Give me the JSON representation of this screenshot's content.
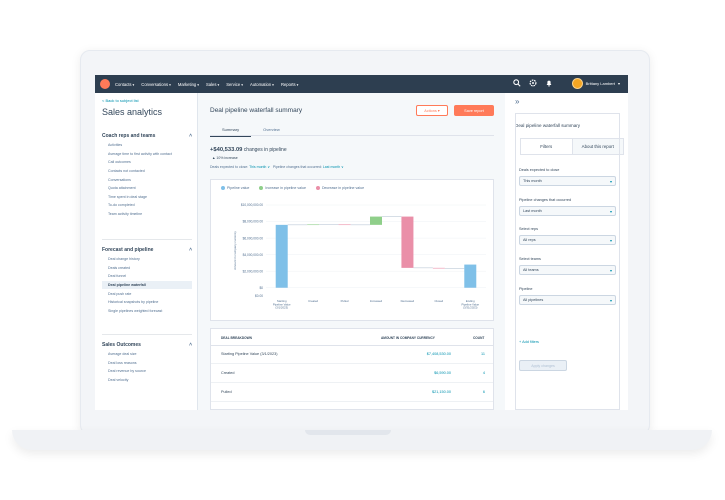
{
  "topnav": {
    "items": [
      "Contacts",
      "Conversations",
      "Marketing",
      "Sales",
      "Service",
      "Automation",
      "Reports"
    ],
    "user_name": "Brittany Lambert"
  },
  "sidebar": {
    "back_link": "< Back to subject list",
    "title": "Sales analytics",
    "sections": [
      {
        "title": "Coach reps and teams",
        "items": [
          "Activities",
          "Average time to first activity with contact",
          "Call outcomes",
          "Contacts not contacted",
          "Conversations",
          "Quota attainment",
          "Time spent in deal stage",
          "To-do completed",
          "Team activity timeline"
        ]
      },
      {
        "title": "Forecast and pipeline",
        "items": [
          "Deal change history",
          "Deals created",
          "Deal funnel",
          "Deal pipeline waterfall",
          "Deal push rate",
          "Historical snapshots by pipeline",
          "Single pipelines weighted forecast"
        ]
      },
      {
        "title": "Sales Outcomes",
        "items": [
          "Average deal size",
          "Deal loss reasons",
          "Deal revenue by source",
          "Deal velocity"
        ]
      }
    ]
  },
  "main": {
    "title": "Deal pipeline waterfall summary",
    "actions_label": "Actions ▾",
    "save_label": "Save report",
    "tabs": [
      "Summary",
      "Overview"
    ],
    "summary_value": "+$40,533.09",
    "summary_text": "changes in pipeline",
    "summary_pct": "▲ 10% increase",
    "filter_prefix": "Deals expected to close:",
    "filter_1": "This month ∨",
    "filter_mid": "Pipeline changes that occurred:",
    "filter_2": "Last month ∨",
    "table": {
      "headers": [
        "DEAL BREAKDOWN",
        "AMOUNT IN COMPANY CURRENCY",
        "COUNT"
      ],
      "rows": [
        {
          "label": "Starting Pipeline Value (3/1/2023)",
          "amount": "$7,408,530.00",
          "count": "11"
        },
        {
          "label": "Created",
          "amount": "$6,590.00",
          "count": "4"
        },
        {
          "label": "Pulled",
          "amount": "$21,150.00",
          "count": "6"
        }
      ]
    }
  },
  "chart_data": {
    "type": "bar",
    "subtype": "waterfall",
    "legend": [
      "Pipeline value",
      "Increase in pipeline value",
      "Decrease in pipeline value"
    ],
    "colors": {
      "pipeline": "#7fc0e8",
      "increase": "#8fcf8a",
      "decrease": "#ea8fa8"
    },
    "ylabel": "Amount in company currency",
    "yticks": [
      "$10,000,000.00",
      "$8,000,000.00",
      "$6,000,000.00",
      "$4,000,000.00",
      "$2,000,000.00",
      "$0",
      "$0.00"
    ],
    "categories": [
      "Starting Pipeline Value (3/1/2023)",
      "Created",
      "Pulled",
      "Increased",
      "Decreased",
      "Closed",
      "Ending Pipeline Value (3/31/2023)"
    ],
    "values": [
      7600000,
      50000,
      -50000,
      1000000,
      -6200000,
      -50000,
      2800000
    ],
    "bar_types": [
      "pipeline",
      "increase",
      "decrease",
      "increase",
      "decrease",
      "decrease",
      "pipeline"
    ],
    "ylim": [
      -1000000,
      10000000
    ]
  },
  "rpanel": {
    "title": "Deal pipeline waterfall summary",
    "tabs": [
      "Filters",
      "About this report"
    ],
    "filters": [
      {
        "label": "Deals expected to close",
        "value": "This month"
      },
      {
        "label": "Pipeline changes that occurred",
        "value": "Last month"
      },
      {
        "label": "Select reps",
        "value": "All reps"
      },
      {
        "label": "Select teams",
        "value": "All teams"
      },
      {
        "label": "Pipeline",
        "value": "All pipelines"
      }
    ],
    "add_filters": "+ Add filters",
    "apply_label": "Apply changes"
  }
}
